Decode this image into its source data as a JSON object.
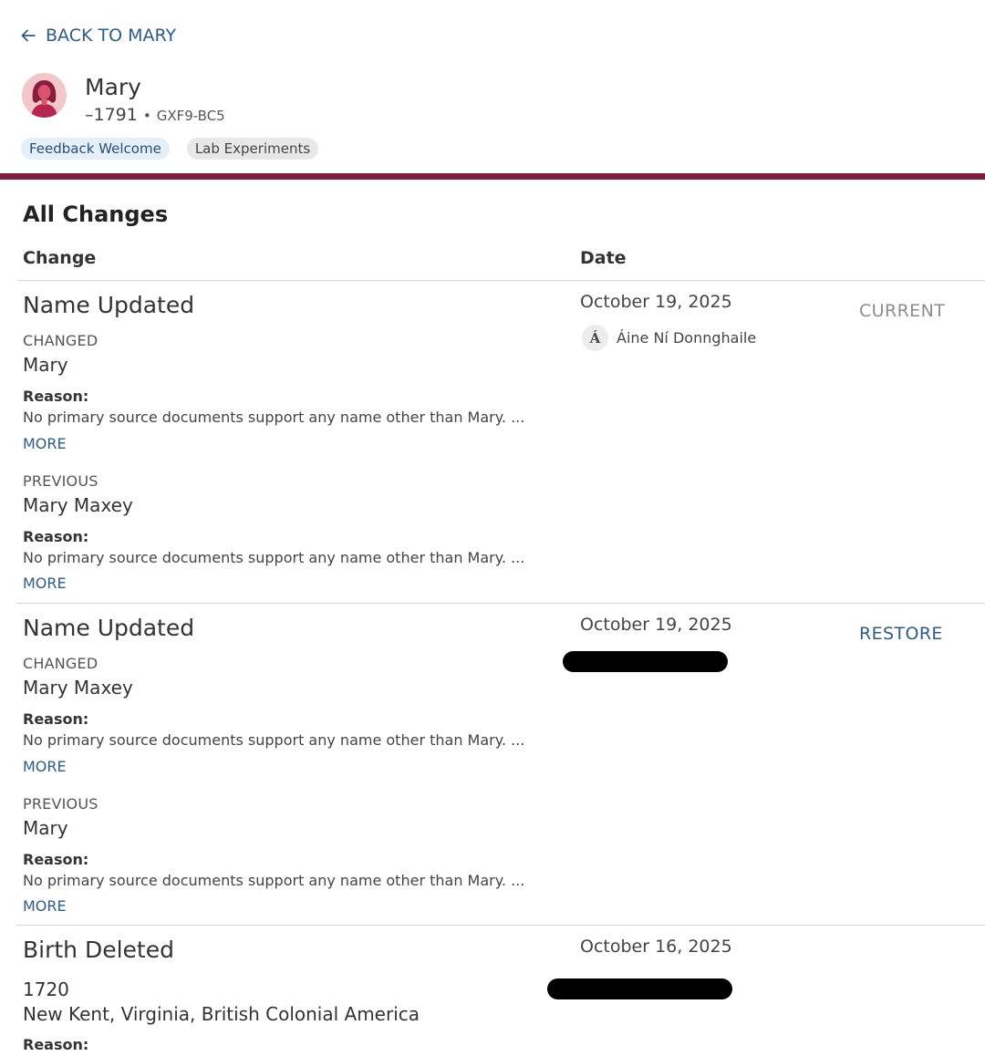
{
  "header": {
    "back_label": "BACK TO MARY",
    "person_name": "Mary",
    "person_dates": "–1791",
    "separator": "•",
    "person_id": "GXF9-BC5",
    "badges": [
      "Feedback Welcome",
      "Lab Experiments"
    ]
  },
  "section_title": "All Changes",
  "columns": {
    "change": "Change",
    "date": "Date"
  },
  "labels": {
    "changed": "CHANGED",
    "previous": "PREVIOUS",
    "reason": "Reason:",
    "more": "MORE"
  },
  "changes": [
    {
      "title": "Name Updated",
      "changed_value": "Mary",
      "changed_reason": "No primary source documents support any name other than Mary.  ...",
      "previous_value": "Mary Maxey",
      "previous_reason": "No primary source documents support any name other than Mary.  ...",
      "date": "October 19, 2025",
      "contributor_initial": "Á",
      "contributor_name": "Áine Ní Donnghaile",
      "status": "CURRENT"
    },
    {
      "title": "Name Updated",
      "changed_value": "Mary Maxey",
      "changed_reason": "No primary source documents support any name other than Mary.  ...",
      "previous_value": "Mary",
      "previous_reason": "No primary source documents support any name other than Mary.  ...",
      "date": "October 19, 2025",
      "status": "RESTORE"
    },
    {
      "title": "Birth Deleted",
      "birth_date": "1720",
      "birth_place": "New Kent, Virginia, British Colonial America",
      "reason_label": "Reason:",
      "date": "October 16, 2025"
    }
  ],
  "colors": {
    "accent_link": "#2f5b84",
    "divider_rule": "#7a1d3f",
    "badge_feedback_bg": "#e4eff9",
    "badge_lab_bg": "#e8e8e8",
    "avatar_bg": "#f3c7c9"
  }
}
